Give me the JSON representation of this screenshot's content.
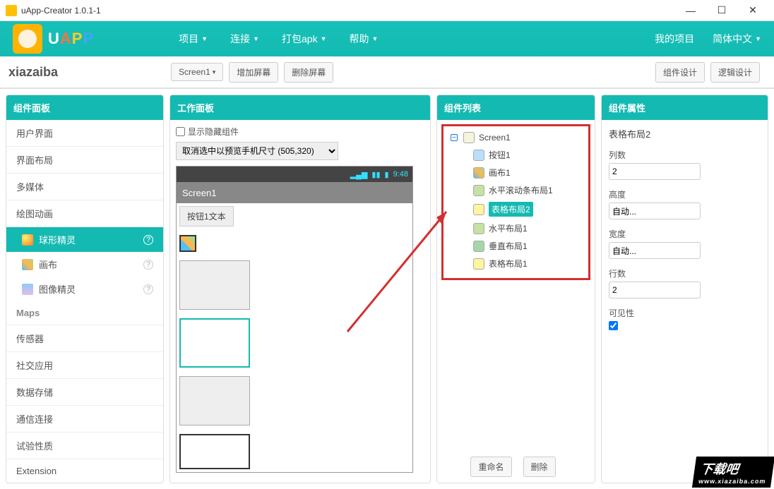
{
  "window": {
    "title": "uApp-Creator 1.0.1-1"
  },
  "logo": {
    "letters": [
      "U",
      "A",
      "P",
      "P"
    ]
  },
  "nav": {
    "items": [
      "项目",
      "连接",
      "打包apk",
      "帮助"
    ],
    "right": [
      "我的项目",
      "简体中文"
    ]
  },
  "subbar": {
    "project": "xiazaiba",
    "screenBtn": "Screen1",
    "addScreen": "增加屏幕",
    "delScreen": "删除屏幕",
    "compDesign": "组件设计",
    "logicDesign": "逻辑设计"
  },
  "panels": {
    "palette": "组件面板",
    "work": "工作面板",
    "list": "组件列表",
    "props": "组件属性"
  },
  "palette": {
    "cats": [
      "用户界面",
      "界面布局",
      "多媒体",
      "绘图动画"
    ],
    "subs": [
      {
        "label": "球形精灵",
        "icon": "si-ball",
        "active": true
      },
      {
        "label": "画布",
        "icon": "si-canvas",
        "active": false
      },
      {
        "label": "图像精灵",
        "icon": "si-sprite",
        "active": false
      }
    ],
    "cats2": [
      "Maps",
      "传感器",
      "社交应用",
      "数据存储",
      "通信连接",
      "试验性质",
      "Extension"
    ]
  },
  "work": {
    "showHidden": "显示隐藏组件",
    "sizeSelect": "取消选中以预览手机尺寸 (505,320)",
    "statusTime": "9:48",
    "screenTitle": "Screen1",
    "buttonText": "按钮1文本"
  },
  "tree": {
    "root": "Screen1",
    "children": [
      {
        "label": "按钮1",
        "icon": "t-btn"
      },
      {
        "label": "画布1",
        "icon": "t-cv"
      },
      {
        "label": "水平滚动条布局1",
        "icon": "t-h"
      },
      {
        "label": "表格布局2",
        "icon": "t-tb",
        "sel": true
      },
      {
        "label": "水平布局1",
        "icon": "t-h"
      },
      {
        "label": "垂直布局1",
        "icon": "t-v"
      },
      {
        "label": "表格布局1",
        "icon": "t-tb"
      }
    ],
    "rename": "重命名",
    "delete": "删除"
  },
  "props": {
    "compName": "表格布局2",
    "fields": {
      "cols": {
        "label": "列数",
        "value": "2"
      },
      "height": {
        "label": "高度",
        "value": "自动..."
      },
      "width": {
        "label": "宽度",
        "value": "自动..."
      },
      "rows": {
        "label": "行数",
        "value": "2"
      },
      "visible": {
        "label": "可见性"
      }
    }
  },
  "watermark": {
    "big": "下载吧",
    "url": "www.xiazaiba.com"
  }
}
